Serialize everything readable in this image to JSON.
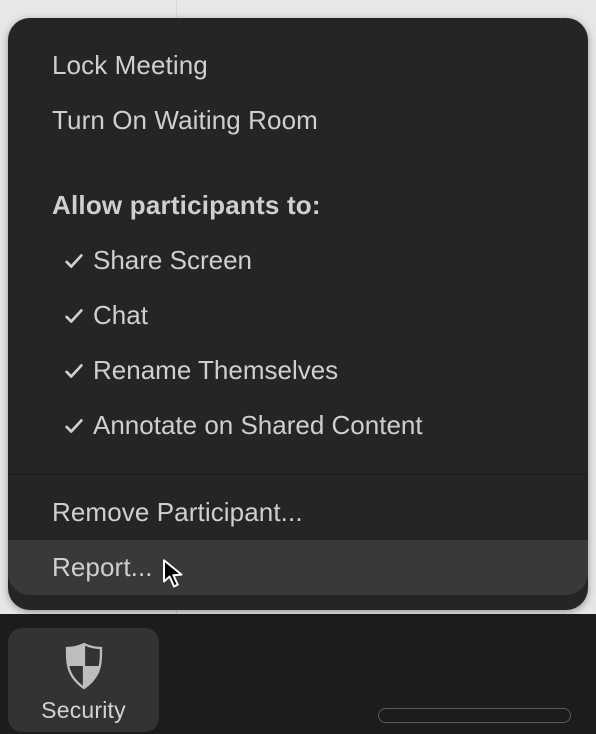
{
  "toolbar": {
    "security_label": "Security"
  },
  "menu": {
    "lock": "Lock Meeting",
    "waiting_room": "Turn On Waiting Room",
    "allow_header": "Allow participants to:",
    "permissions": {
      "share": "Share Screen",
      "chat": "Chat",
      "rename": "Rename Themselves",
      "annotate": "Annotate on Shared Content"
    },
    "remove": "Remove Participant...",
    "report": "Report..."
  }
}
